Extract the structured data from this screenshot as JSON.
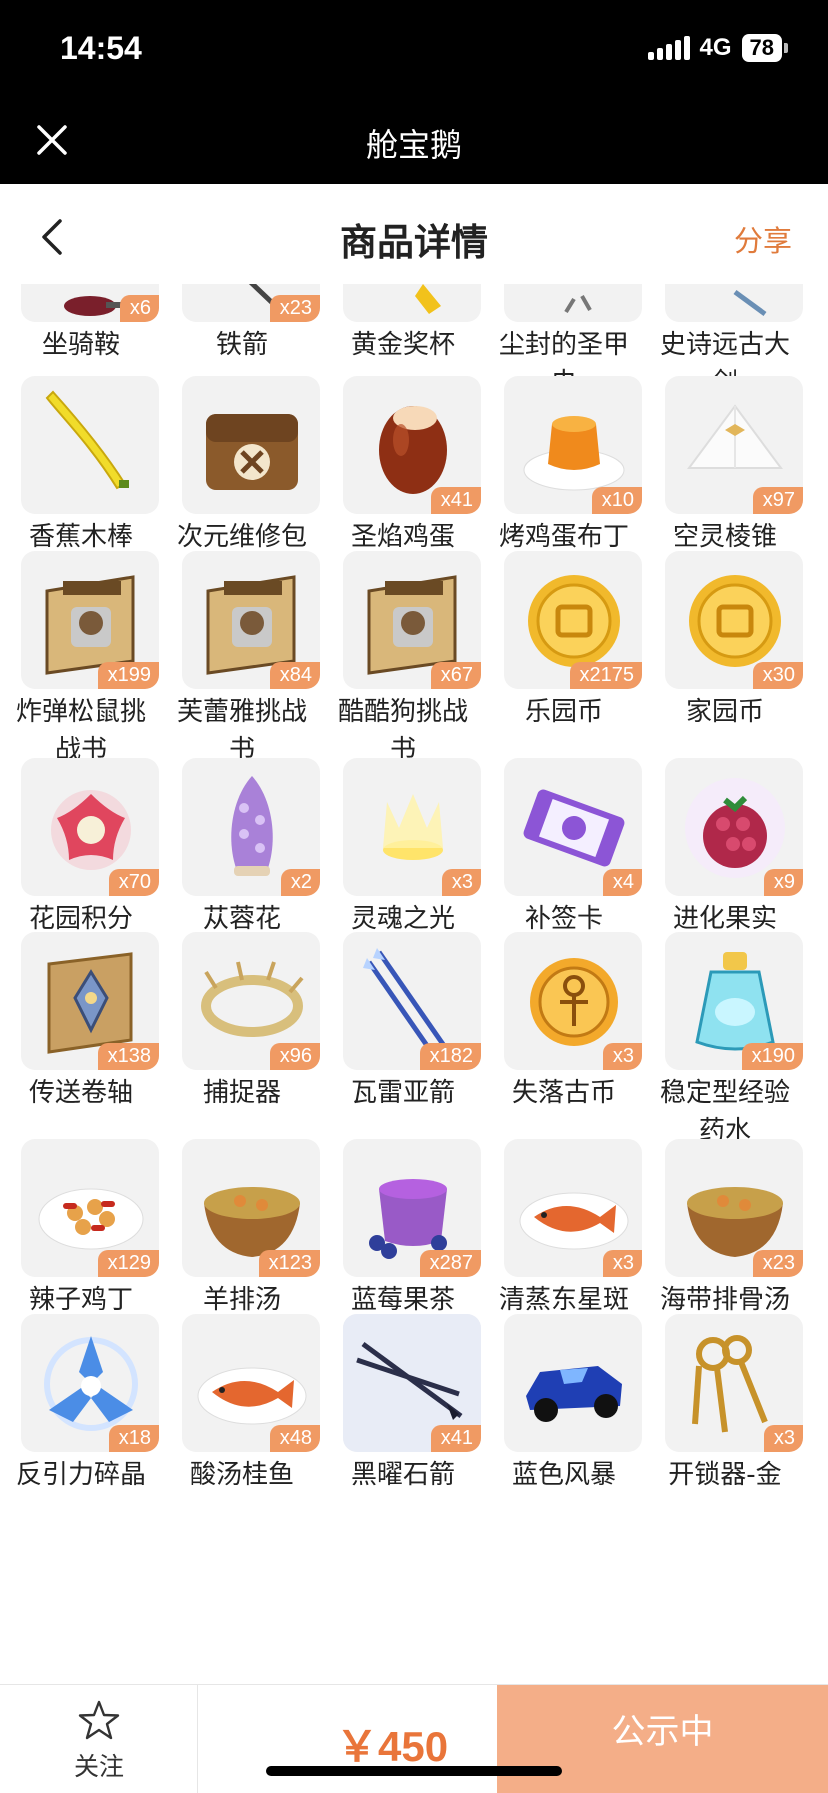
{
  "status_bar": {
    "time": "14:54",
    "network": "4G",
    "battery": "78"
  },
  "miniapp": {
    "title": "舱宝鹅"
  },
  "nav": {
    "title": "商品详情",
    "share": "分享"
  },
  "colors": {
    "accent": "#e9753a",
    "badge": "#f09a63",
    "publish_bg": "#f4ae88"
  },
  "items": [
    {
      "name": "坐骑鞍",
      "count": "x6",
      "icon": "saddle-icon"
    },
    {
      "name": "铁箭",
      "count": "x23",
      "icon": "iron-arrow-icon"
    },
    {
      "name": "黄金奖杯",
      "count": "",
      "icon": "gold-trophy-icon"
    },
    {
      "name": "尘封的圣甲虫",
      "count": "",
      "icon": "scarab-icon"
    },
    {
      "name": "史诗远古大剑",
      "count": "",
      "icon": "sword-icon"
    },
    {
      "name": "香蕉木棒",
      "count": "",
      "icon": "banana-stick-icon"
    },
    {
      "name": "次元维修包",
      "count": "",
      "icon": "repair-bag-icon"
    },
    {
      "name": "圣焰鸡蛋",
      "count": "x41",
      "icon": "egg-icon"
    },
    {
      "name": "烤鸡蛋布丁",
      "count": "x10",
      "icon": "pudding-icon"
    },
    {
      "name": "空灵棱锥",
      "count": "x97",
      "icon": "pyramid-icon"
    },
    {
      "name": "炸弹松鼠挑战书",
      "count": "x199",
      "icon": "wanted-scroll-icon"
    },
    {
      "name": "芙蕾雅挑战书",
      "count": "x84",
      "icon": "wanted-scroll-icon"
    },
    {
      "name": "酷酷狗挑战书",
      "count": "x67",
      "icon": "wanted-scroll-icon"
    },
    {
      "name": "乐园币",
      "count": "x2175",
      "icon": "gold-coin-icon"
    },
    {
      "name": "家园币",
      "count": "x30",
      "icon": "gold-coin-icon"
    },
    {
      "name": "花园积分",
      "count": "x70",
      "icon": "flower-badge-icon"
    },
    {
      "name": "苁蓉花",
      "count": "x2",
      "icon": "purple-flower-icon"
    },
    {
      "name": "灵魂之光",
      "count": "x3",
      "icon": "soul-light-icon"
    },
    {
      "name": "补签卡",
      "count": "x4",
      "icon": "ticket-icon"
    },
    {
      "name": "进化果实",
      "count": "x9",
      "icon": "berry-icon"
    },
    {
      "name": "传送卷轴",
      "count": "x138",
      "icon": "scroll-icon"
    },
    {
      "name": "捕捉器",
      "count": "x96",
      "icon": "thorn-ring-icon"
    },
    {
      "name": "瓦雷亚箭",
      "count": "x182",
      "icon": "blue-arrows-icon"
    },
    {
      "name": "失落古币",
      "count": "x3",
      "icon": "ankh-coin-icon"
    },
    {
      "name": "稳定型经验药水",
      "count": "x190",
      "icon": "potion-icon"
    },
    {
      "name": "辣子鸡丁",
      "count": "x129",
      "icon": "spicy-chicken-icon"
    },
    {
      "name": "羊排汤",
      "count": "x123",
      "icon": "soup-icon"
    },
    {
      "name": "蓝莓果茶",
      "count": "x287",
      "icon": "blueberry-tea-icon"
    },
    {
      "name": "清蒸东星斑",
      "count": "x3",
      "icon": "fish-dish-icon"
    },
    {
      "name": "海带排骨汤",
      "count": "x23",
      "icon": "soup-icon"
    },
    {
      "name": "反引力碎晶",
      "count": "x18",
      "icon": "crystal-icon"
    },
    {
      "name": "酸汤桂鱼",
      "count": "x48",
      "icon": "fish-dish-icon"
    },
    {
      "name": "黑曜石箭",
      "count": "x41",
      "icon": "obsidian-arrow-icon"
    },
    {
      "name": "蓝色风暴",
      "count": "",
      "icon": "race-car-icon"
    },
    {
      "name": "开锁器-金",
      "count": "x3",
      "icon": "gold-keys-icon"
    }
  ],
  "bottom_bar": {
    "follow": "关注",
    "price": "￥450",
    "status": "公示中"
  }
}
